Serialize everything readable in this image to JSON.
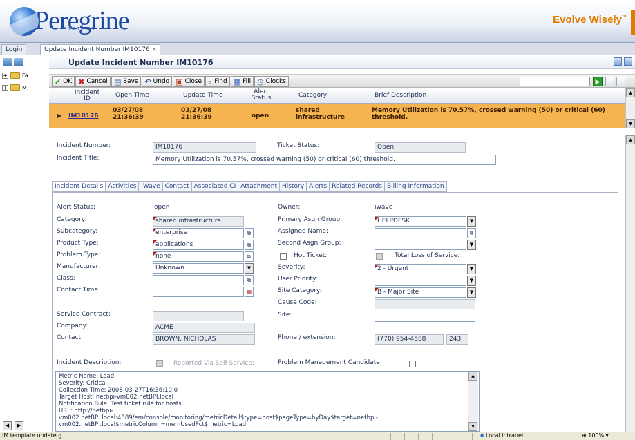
{
  "banner": {
    "brand": "Peregrine",
    "brand_sub": "SYSTEMS.",
    "tagline": "Evolve Wisely",
    "tagline_tm": "™"
  },
  "tabs": {
    "login": "Login",
    "active": "Update Incident Number IM10176",
    "close_glyph": "x"
  },
  "leftnav": {
    "items": [
      {
        "label": "Fa",
        "icon": "folder-icon"
      },
      {
        "label": "M",
        "icon": "folder-icon"
      }
    ]
  },
  "page": {
    "title": "Update Incident Number IM10176"
  },
  "toolbar": {
    "ok": "OK",
    "cancel": "Cancel",
    "save": "Save",
    "undo": "Undo",
    "close": "Close",
    "find": "Find",
    "fill": "Fill",
    "clocks": "Clocks",
    "search_value": ""
  },
  "grid": {
    "columns": [
      "Incident ID",
      "Open Time",
      "Update Time",
      "Alert Status",
      "Category",
      "Brief Description"
    ],
    "rows": [
      {
        "id": "IM10176",
        "open_date": "03/27/08",
        "open_time": "21:36:39",
        "update_date": "03/27/08",
        "update_time": "21:36:39",
        "alert_status": "open",
        "category_1": "shared",
        "category_2": "infrastructure",
        "brief_1": "Memory Utilization is 70.57%, crossed warning (50) or critical (60)",
        "brief_2": "threshold."
      }
    ]
  },
  "detail": {
    "incident_number_label": "Incident Number:",
    "incident_number": "IM10176",
    "ticket_status_label": "Ticket Status:",
    "ticket_status": "Open",
    "incident_title_label": "Incident Title:",
    "incident_title": "Memory Utilization is 70.57%, crossed warning (50) or critical (60) threshold.",
    "subtabs": [
      "Incident Details",
      "Activities",
      "iWave",
      "Contact",
      "Associated CI",
      "Attachment",
      "History",
      "Alerts",
      "Related Records",
      "Billing Information"
    ],
    "alert_status_label": "Alert Status:",
    "alert_status": "open",
    "owner_label": "Owner:",
    "owner": "iwave",
    "category_label": "Category:",
    "category": "shared infrastructure",
    "primary_group_label": "Primary Asgn Group:",
    "primary_group": "HELPDESK",
    "subcategory_label": "Subcategory:",
    "subcategory": "enterprise",
    "assignee_label": "Assignee Name:",
    "assignee": "",
    "product_type_label": "Product Type:",
    "product_type": "applications",
    "second_group_label": "Second Asgn Group:",
    "second_group": "",
    "problem_type_label": "Problem Type:",
    "problem_type": "none",
    "hot_ticket_label": "Hot Ticket:",
    "total_loss_label": "Total Loss of Service:",
    "manufacturer_label": "Manufacturer:",
    "manufacturer": "Unknown",
    "severity_label": "Severity:",
    "severity": "2 - Urgent",
    "class_label": "Class:",
    "class": "",
    "user_priority_label": "User Priority:",
    "user_priority": "",
    "contact_time_label": "Contact Time:",
    "contact_time": "",
    "site_category_label": "Site Category:",
    "site_category": "B - Major Site",
    "cause_code_label": "Cause Code:",
    "cause_code": "",
    "service_contract_label": "Service Contract:",
    "service_contract": "",
    "site_label": "Site:",
    "site": "",
    "company_label": "Company:",
    "company": "ACME",
    "contact_label": "Contact:",
    "contact": "BROWN, NICHOLAS",
    "phone_label": "Phone / extension:",
    "phone": "(770) 954-4588",
    "extension": "243",
    "description_label": "Incident Description:",
    "self_service_label": "Reported Via Self Service:",
    "pm_candidate_label": "Problem Management Candidate",
    "description_lines": [
      "Metric Name: Load",
      "Severity: Critical",
      "Collection Time: 2008-03-27T16:36:10.0",
      "Target Host: netbpi-vm002.netBPI.local",
      "Notification Rule: Test ticket rule for hosts",
      "URL: http://netbpi-",
      "vm002.netBPI.local:4889/em/console/monitoring/metricDetail$type=host$pageType=byDay$target=netbpi-",
      "vm002.netBPI.local$metricColumn=memUsedPct$metric=Load"
    ]
  },
  "statusbar": {
    "text": "IM.template.update.g",
    "zone": "Local intranet",
    "zoom": "100%"
  }
}
